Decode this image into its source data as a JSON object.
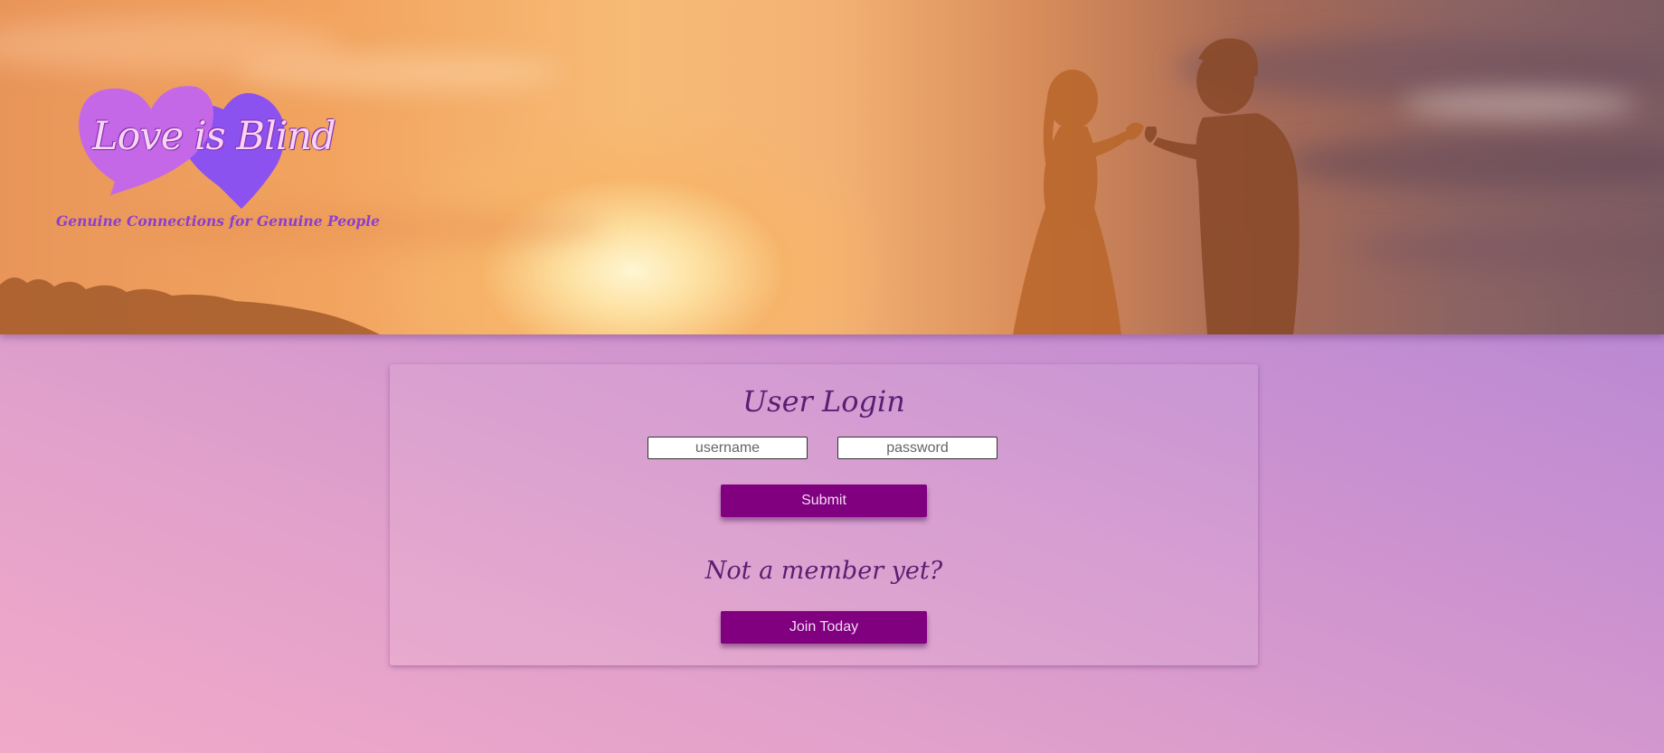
{
  "brand": {
    "logo_text": "Love is Blind",
    "tagline": "Genuine Connections for Genuine People",
    "colors": {
      "heart_left": "#c468e8",
      "heart_right": "#8c52f0",
      "primary_button": "#800080",
      "title_text": "#5a1e72"
    }
  },
  "hero": {
    "image": "sunset-couple-heart-hands"
  },
  "login": {
    "title": "User Login",
    "username_placeholder": "username",
    "password_placeholder": "password",
    "submit_label": "Submit",
    "signup_prompt": "Not a member yet?",
    "join_label": "Join Today"
  }
}
